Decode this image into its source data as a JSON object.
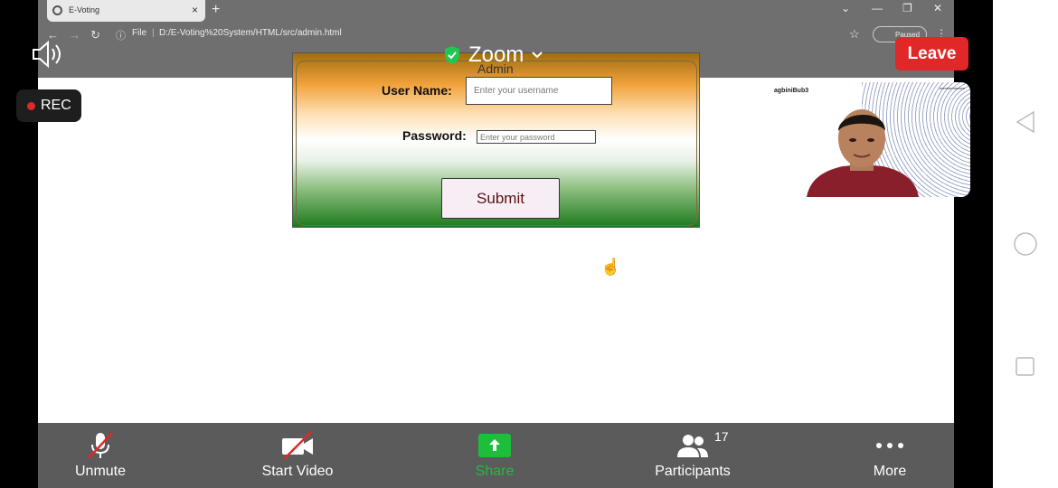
{
  "browser": {
    "tab_title": "E-Voting",
    "tab_close": "×",
    "new_tab": "+",
    "url_scheme": "File",
    "url": "D:/E-Voting%20System/HTML/src/admin.html",
    "profile_status": "Paused",
    "window_controls": [
      "⌄",
      "—",
      "❐",
      "✕"
    ]
  },
  "zoom": {
    "title": "Zoom",
    "leave_label": "Leave",
    "rec_label": "REC",
    "accent_leave": "#e02828",
    "accent_share": "#1dbf3a"
  },
  "form": {
    "heading": "Admin",
    "username_label": "User Name:",
    "username_placeholder": "Enter your username",
    "password_label": "Password:",
    "password_placeholder": "Enter your password",
    "submit_label": "Submit"
  },
  "video": {
    "logo_text": "agbiniBub3",
    "corner_text": "meeeermeeeee"
  },
  "toolbar": {
    "unmute_label": "Unmute",
    "start_video_label": "Start Video",
    "share_label": "Share",
    "participants_label": "Participants",
    "participants_count": "17",
    "more_label": "More"
  },
  "icons": {
    "speaker": "speaker-icon",
    "shield": "shield-check-icon",
    "mic": "mic-muted-icon",
    "camera": "camera-off-icon",
    "share": "share-up-arrow-icon",
    "participants": "participants-icon",
    "more": "more-dots-icon",
    "android_back": "back-triangle-icon",
    "android_home": "home-circle-icon",
    "android_recent": "recent-square-icon"
  }
}
